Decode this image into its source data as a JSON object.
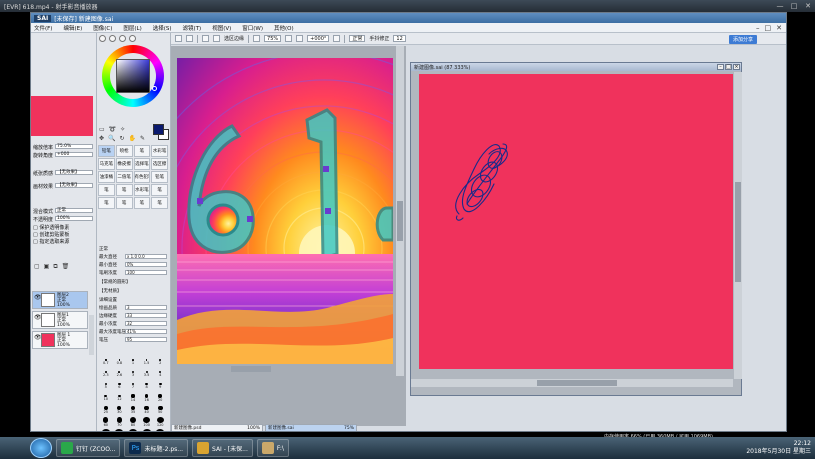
{
  "player": {
    "title": "[EVR] 618.mp4 - 射手影音播放器",
    "controls": [
      "—",
      "□",
      "✕"
    ]
  },
  "sai": {
    "window_title": "[未保存] 新建图像.sai",
    "logo": "SAI",
    "menus": [
      "文件(F)",
      "编辑(E)",
      "图像(C)",
      "图层(L)",
      "选择(S)",
      "滤镜(T)",
      "视图(V)",
      "窗口(W)",
      "其他(O)"
    ],
    "toolbar": {
      "select_checkbox": "选区边缘",
      "zoom": "75%",
      "angle": "+000°",
      "blend": "正常",
      "stabilizer_label": "手抖修正",
      "stabilizer_value": "12"
    },
    "corner_link": "添加分享",
    "left_panel": {
      "zoom_label": "缩放倍率",
      "zoom_value": "75.0%",
      "angle_label": "旋转角度",
      "angle_value": "+000",
      "filter1_label": "纸张质感",
      "filter1_value": "【无效果】",
      "filter2_label": "画材效果",
      "filter2_value": "【无效果】",
      "blend_label": "混合模式",
      "blend_value": "正常",
      "opacity_label": "不透明度",
      "opacity_value": "100%",
      "checks": [
        "保护透明像素",
        "创建剪贴蒙板",
        "指定选取来源"
      ],
      "layers": [
        {
          "name": "图层2",
          "sub": "正常",
          "opacity": "100%"
        },
        {
          "name": "图层1",
          "sub": "正常",
          "opacity": "100%"
        },
        {
          "name": "图层 1",
          "sub": "正常",
          "opacity": "100%"
        }
      ]
    },
    "tool_panel": {
      "brushes": [
        "铅笔",
        "喷枪",
        "笔",
        "水彩笔",
        "马克笔",
        "橡皮擦",
        "选择笔",
        "选区擦",
        "油漆桶",
        "二值笔",
        "有色铅笔",
        "铅笔",
        "笔",
        "笔",
        "水彩笔",
        "笔",
        "笔",
        "笔",
        "笔",
        "笔"
      ],
      "labels": {
        "blend": "正常",
        "size_label": "最大直径",
        "size_value": "x 1.0  0.0",
        "min_label": "最小直径",
        "min_value": "0%",
        "density_label": "笔刷浓度",
        "density_value": "100",
        "shape": "【常规的圆形】",
        "texture": "【无材质】",
        "detail": "详细设置",
        "quality_label": "绘画品质",
        "quality_value": "3",
        "edge_label": "边缘硬度",
        "edge_value": "33",
        "min_dens_label": "最小浓度",
        "min_dens_value": "32",
        "max_pressure_label": "最大浓度笔压",
        "max_pressure_value": "41%",
        "pressure_label": "笔压",
        "pressure_value": "95"
      },
      "sizes": [
        "0.7",
        "0.8",
        "1",
        "1.5",
        "2",
        "2.3",
        "2.6",
        "3",
        "3.5",
        "4",
        "5",
        "6",
        "7",
        "8",
        "9",
        "10",
        "12",
        "14",
        "16",
        "20",
        "25",
        "30",
        "35",
        "40",
        "50",
        "60",
        "70",
        "80",
        "100",
        "120",
        "160",
        "200",
        "250",
        "300",
        "350"
      ]
    },
    "canvas2_title": "新建图像.sai (87 333%)",
    "doc_tabs": [
      {
        "name": "新建图像.psd",
        "zoom": "100%"
      },
      {
        "name": "新建图像.sai",
        "zoom": "75%"
      }
    ],
    "status": "内存使用率 66%  (已用 360MB / 可用 1069MB)"
  },
  "taskbar": {
    "apps": [
      {
        "label": "钉钉 (ZCOO...",
        "color": "#2aa84a"
      },
      {
        "label": "未标题-2.ps...",
        "color": "#0c2a4d"
      },
      {
        "label": "SAI - [未保...",
        "color": "#d9a431"
      },
      {
        "label": "F:\\",
        "color": "#caa86a"
      }
    ],
    "time": "22:12",
    "date": "2018年5月30日 星期三"
  },
  "chart_data": null
}
